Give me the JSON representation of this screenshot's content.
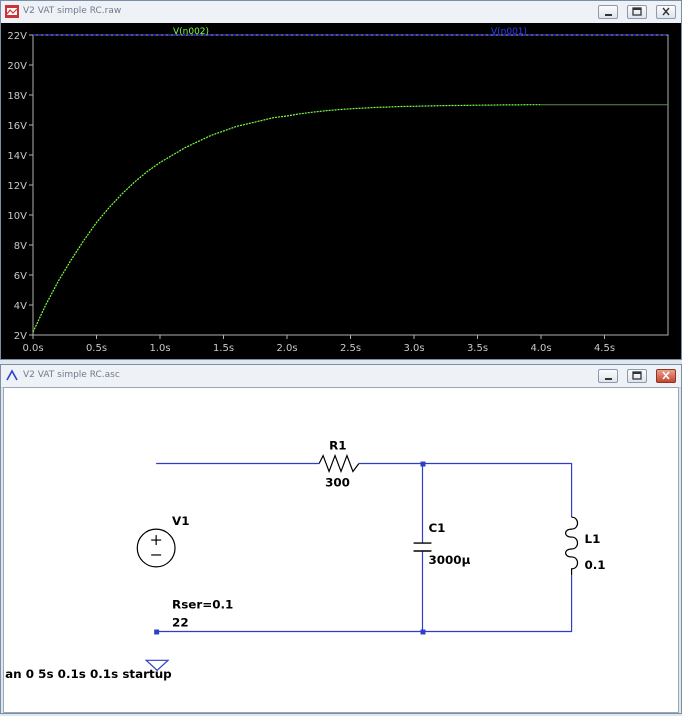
{
  "plot_window": {
    "title": "V2 VAT simple RC.raw",
    "buttons": [
      "minimize",
      "restore",
      "close"
    ]
  },
  "schematic_window": {
    "title": "V2 VAT simple RC.asc",
    "buttons": [
      "minimize",
      "restore",
      "close"
    ]
  },
  "chart_data": {
    "type": "line",
    "background": "#000000",
    "x_ticks": [
      "0.0s",
      "0.5s",
      "1.0s",
      "1.5s",
      "2.0s",
      "2.5s",
      "3.0s",
      "3.5s",
      "4.0s",
      "4.5s"
    ],
    "y_ticks": [
      "2V",
      "4V",
      "6V",
      "8V",
      "10V",
      "12V",
      "14V",
      "16V",
      "18V",
      "20V",
      "22V"
    ],
    "xlim": [
      0,
      5
    ],
    "ylim": [
      2,
      22
    ],
    "grid": false,
    "series": [
      {
        "name": "V(n002)",
        "color": "#7cff4a",
        "x": [
          0,
          0.1,
          0.2,
          0.3,
          0.4,
          0.5,
          0.6,
          0.7,
          0.8,
          0.9,
          1.0,
          1.1,
          1.2,
          1.3,
          1.4,
          1.5,
          1.6,
          1.7,
          1.8,
          1.9,
          2.0,
          2.1,
          2.2,
          2.3,
          2.4,
          2.5,
          2.6,
          2.7,
          2.8,
          2.9,
          3.0,
          3.1,
          3.2,
          3.3,
          3.4,
          3.5,
          3.6,
          3.7,
          3.8,
          3.9,
          4.0
        ],
        "y": [
          2.2,
          4.0,
          5.6,
          7.0,
          8.3,
          9.5,
          10.5,
          11.4,
          12.2,
          12.9,
          13.5,
          14.0,
          14.5,
          14.9,
          15.3,
          15.6,
          15.9,
          16.1,
          16.3,
          16.5,
          16.6,
          16.75,
          16.85,
          16.95,
          17.02,
          17.08,
          17.13,
          17.17,
          17.2,
          17.23,
          17.25,
          17.27,
          17.29,
          17.3,
          17.31,
          17.32,
          17.33,
          17.34,
          17.34,
          17.35,
          17.35
        ]
      },
      {
        "name": "V(n001)",
        "color": "#2f3dff",
        "x": [
          0,
          5
        ],
        "y": [
          22,
          22
        ]
      }
    ],
    "extra_marks": [
      {
        "name": "V(n002) flat continuation",
        "color": "#5b8a4a",
        "x": [
          4.0,
          5.0
        ],
        "y": [
          17.35,
          17.35
        ]
      }
    ]
  },
  "schematic": {
    "line_color": "#2f3ec8",
    "node_color": "#2f3ec8",
    "components": {
      "r1": {
        "name": "R1",
        "value": "300"
      },
      "c1": {
        "name": "C1",
        "value": "3000µ"
      },
      "l1": {
        "name": "L1",
        "value": "0.1"
      },
      "v1": {
        "name": "V1",
        "rser": "Rser=0.1",
        "value": "22"
      }
    },
    "directive": "an 0 5s 0.1s 0.1s startup"
  }
}
